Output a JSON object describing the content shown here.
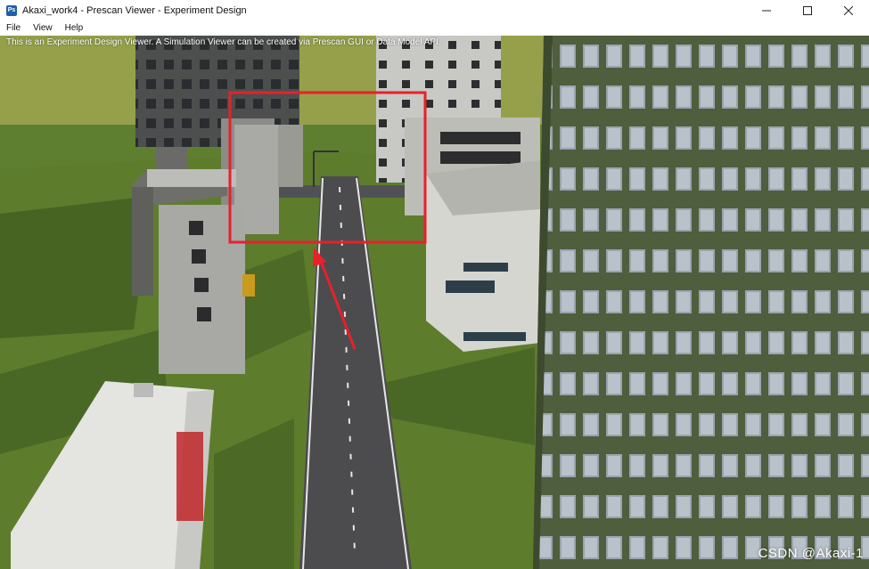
{
  "window": {
    "title": "Akaxi_work4 - Prescan Viewer - Experiment Design",
    "app_icon_text": "Ps",
    "controls": [
      "minimize",
      "maximize",
      "close"
    ]
  },
  "menu": {
    "items": [
      {
        "label": "File"
      },
      {
        "label": "View"
      },
      {
        "label": "Help"
      }
    ]
  },
  "viewer": {
    "info_text": "This is an Experiment Design Viewer. A Simulation Viewer can be created via Prescan GUI or Data Model API.",
    "highlight_box_color": "#e8202a",
    "arrow_color": "#e8202a"
  },
  "watermark": "CSDN @Akaxi-1",
  "colors": {
    "grass": "#5b7a2e",
    "road": "#4a4a4c",
    "sky_ground": "#8a9a44"
  }
}
